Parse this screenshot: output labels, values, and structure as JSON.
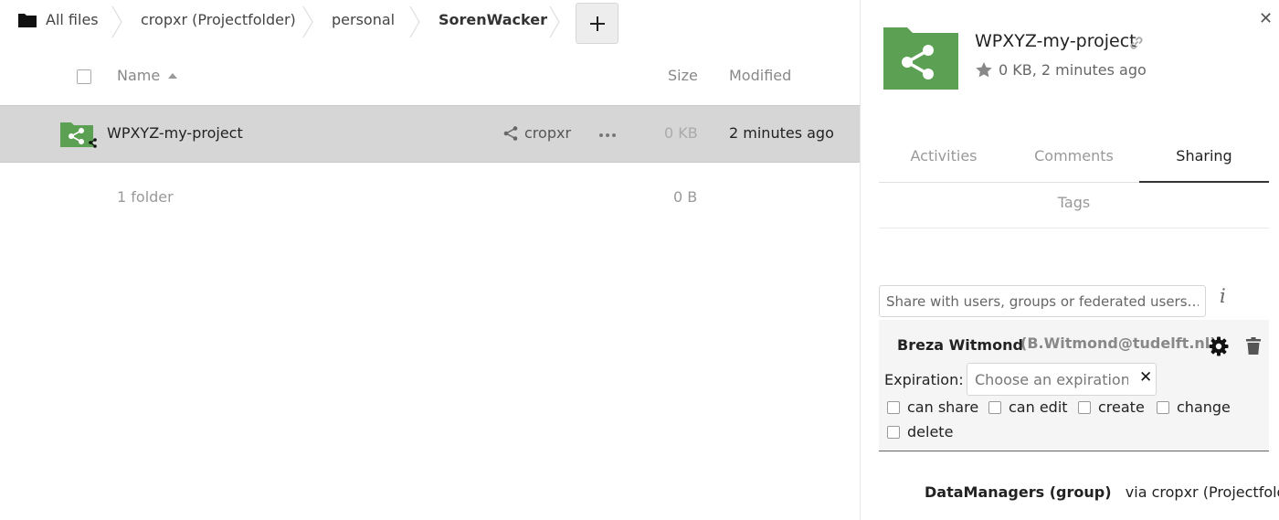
{
  "breadcrumb": {
    "items": [
      "All files",
      "cropxr (Projectfolder)",
      "personal",
      "SorenWacker"
    ],
    "add_label": "+"
  },
  "list": {
    "header": {
      "name": "Name",
      "size": "Size",
      "modified": "Modified"
    },
    "files": [
      {
        "name": "WPXYZ-my-project",
        "share_owner": "cropxr",
        "size": "0 KB",
        "modified": "2 minutes ago"
      }
    ],
    "summary": {
      "count": "1 folder",
      "size": "0 B"
    }
  },
  "sidebar": {
    "title": "WPXYZ-my-project",
    "meta": "0 KB, 2 minutes ago",
    "close_label": "✕",
    "tabs": [
      "Activities",
      "Comments",
      "Sharing"
    ],
    "active_tab": "Sharing",
    "tags_tab": "Tags",
    "share_placeholder": "Share with users, groups or federated users…",
    "info_label": "i",
    "share_entry": {
      "name": "Breza Witmond",
      "email": "(B.Witmond@tudelft.nl)",
      "expiration_label": "Expiration:",
      "expiration_placeholder": "Choose an expiration date",
      "clear_label": "✕",
      "permissions": [
        "can share",
        "can edit",
        "create",
        "change",
        "delete"
      ]
    },
    "inherited": {
      "name": "DataManagers (group)",
      "via": "via cropxr (Projectfolder)"
    }
  },
  "colors": {
    "folder_green": "#5ca053",
    "selected_row": "#d6d6d6"
  }
}
